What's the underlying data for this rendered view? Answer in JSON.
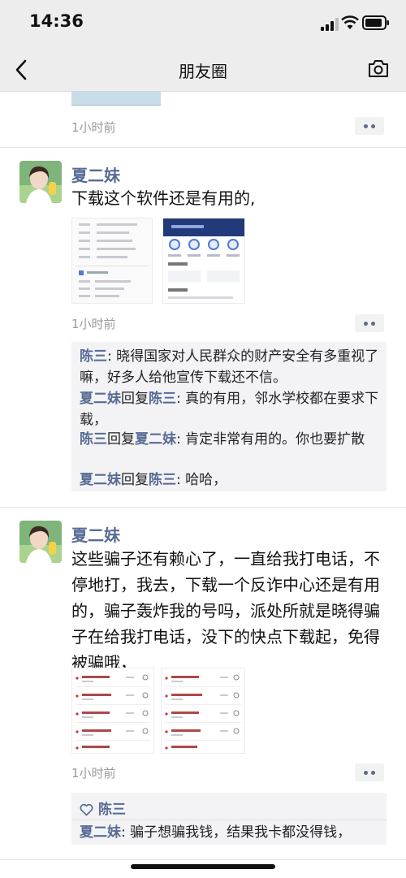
{
  "status": {
    "time": "14:36"
  },
  "nav": {
    "title": "朋友圈"
  },
  "feed": {
    "top_time": "1小时前",
    "post1": {
      "author": "夏二妹",
      "text": "下载这个软件还是有用的,",
      "time": "1小时前",
      "comments": [
        {
          "from": "陈三",
          "to": "",
          "text": "晓得国家对人民群众的财产安全有多重视了嘛，好多人给他宣传下载还不信。"
        },
        {
          "from": "夏二妹",
          "to": "陈三",
          "text": "真的有用，邻水学校都在要求下载，"
        },
        {
          "from": "陈三",
          "to": "夏二妹",
          "text": "肯定非常有用的。你也要扩散"
        },
        {
          "from": "夏二妹",
          "to": "陈三",
          "text": "哈哈，"
        }
      ]
    },
    "post2": {
      "author": "夏二妹",
      "text": "这些骗子还有赖心了，一直给我打电话，不停地打，我去，下载一个反诈中心还是有用的，骗子轰炸我的号吗，派处所就是晓得骗子在给我打电话，没下的快点下载起，免得被骗哦，",
      "time": "1小时前",
      "likes": "陈三",
      "comments": [
        {
          "from": "夏二妹",
          "to": "",
          "text": "骗子想骗我钱，结果我卡都没得钱，"
        }
      ]
    }
  },
  "labels": {
    "reply": "回复",
    "colon": ": "
  },
  "colors": {
    "name": "#576b95",
    "bar": "#ededed",
    "comment_bg": "#f3f3f5"
  }
}
